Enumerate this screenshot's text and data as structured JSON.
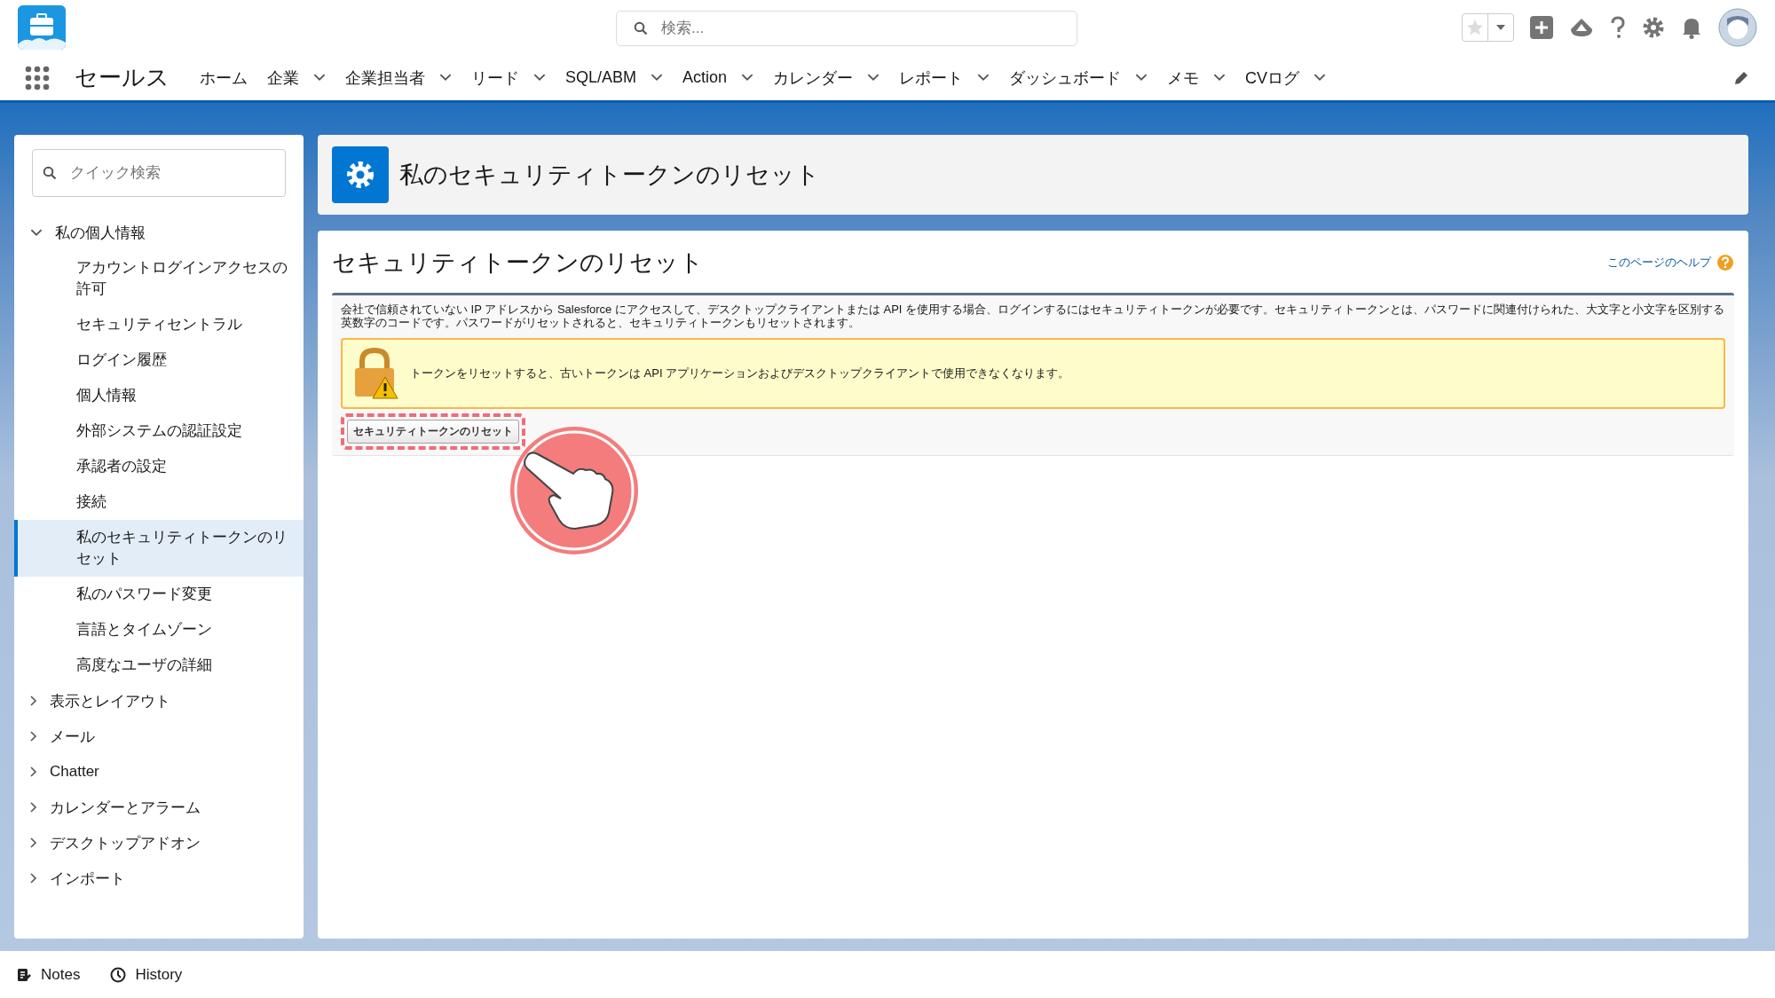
{
  "header": {
    "search": {
      "placeholder": "検索..."
    }
  },
  "nav": {
    "app_name": "セールス",
    "items": [
      {
        "label": "ホーム",
        "dropdown": false
      },
      {
        "label": "企業",
        "dropdown": true
      },
      {
        "label": "企業担当者",
        "dropdown": true
      },
      {
        "label": "リード",
        "dropdown": true
      },
      {
        "label": "SQL/ABM",
        "dropdown": true
      },
      {
        "label": "Action",
        "dropdown": true
      },
      {
        "label": "カレンダー",
        "dropdown": true
      },
      {
        "label": "レポート",
        "dropdown": true
      },
      {
        "label": "ダッシュボード",
        "dropdown": true
      },
      {
        "label": "メモ",
        "dropdown": true
      },
      {
        "label": "CVログ",
        "dropdown": true
      }
    ]
  },
  "sidebar": {
    "search": {
      "placeholder": "クイック検索"
    },
    "tree": [
      {
        "label": "私の個人情報",
        "expanded": true,
        "selected": false,
        "children": [
          {
            "label": "アカウントログインアクセスの許可",
            "selected": false
          },
          {
            "label": "セキュリティセントラル",
            "selected": false
          },
          {
            "label": "ログイン履歴",
            "selected": false
          },
          {
            "label": "個人情報",
            "selected": false
          },
          {
            "label": "外部システムの認証設定",
            "selected": false
          },
          {
            "label": "承認者の設定",
            "selected": false
          },
          {
            "label": "接続",
            "selected": false
          },
          {
            "label": "私のセキュリティトークンのリセット",
            "selected": true
          },
          {
            "label": "私のパスワード変更",
            "selected": false
          },
          {
            "label": "言語とタイムゾーン",
            "selected": false
          },
          {
            "label": "高度なユーザの詳細",
            "selected": false
          }
        ]
      },
      {
        "label": "表示とレイアウト",
        "expanded": false,
        "selected": false
      },
      {
        "label": "メール",
        "expanded": false,
        "selected": false
      },
      {
        "label": "Chatter",
        "expanded": false,
        "selected": false
      },
      {
        "label": "カレンダーとアラーム",
        "expanded": false,
        "selected": false
      },
      {
        "label": "デスクトップアドオン",
        "expanded": false,
        "selected": false
      },
      {
        "label": "インポート",
        "expanded": false,
        "selected": false
      }
    ]
  },
  "page_header": {
    "title": "私のセキュリティトークンのリセット"
  },
  "main": {
    "title": "セキュリティトークンのリセット",
    "help_link": "このページのヘルプ",
    "description": "会社で信頼されていない IP アドレスから Salesforce にアクセスして、デスクトップクライアントまたは API を使用する場合、ログインするにはセキュリティトークンが必要です。セキュリティトークンとは、パスワードに関連付けられた、大文字と小文字を区別する英数字のコードです。パスワードがリセットされると、セキュリティトークンもリセットされます。",
    "warning": "トークンをリセットすると、古いトークンは API アプリケーションおよびデスクトップクライアントで使用できなくなります。",
    "button": "セキュリティトークンのリセット"
  },
  "footer": {
    "items": [
      {
        "kind": "notes",
        "label": "Notes"
      },
      {
        "kind": "history",
        "label": "History"
      }
    ]
  }
}
